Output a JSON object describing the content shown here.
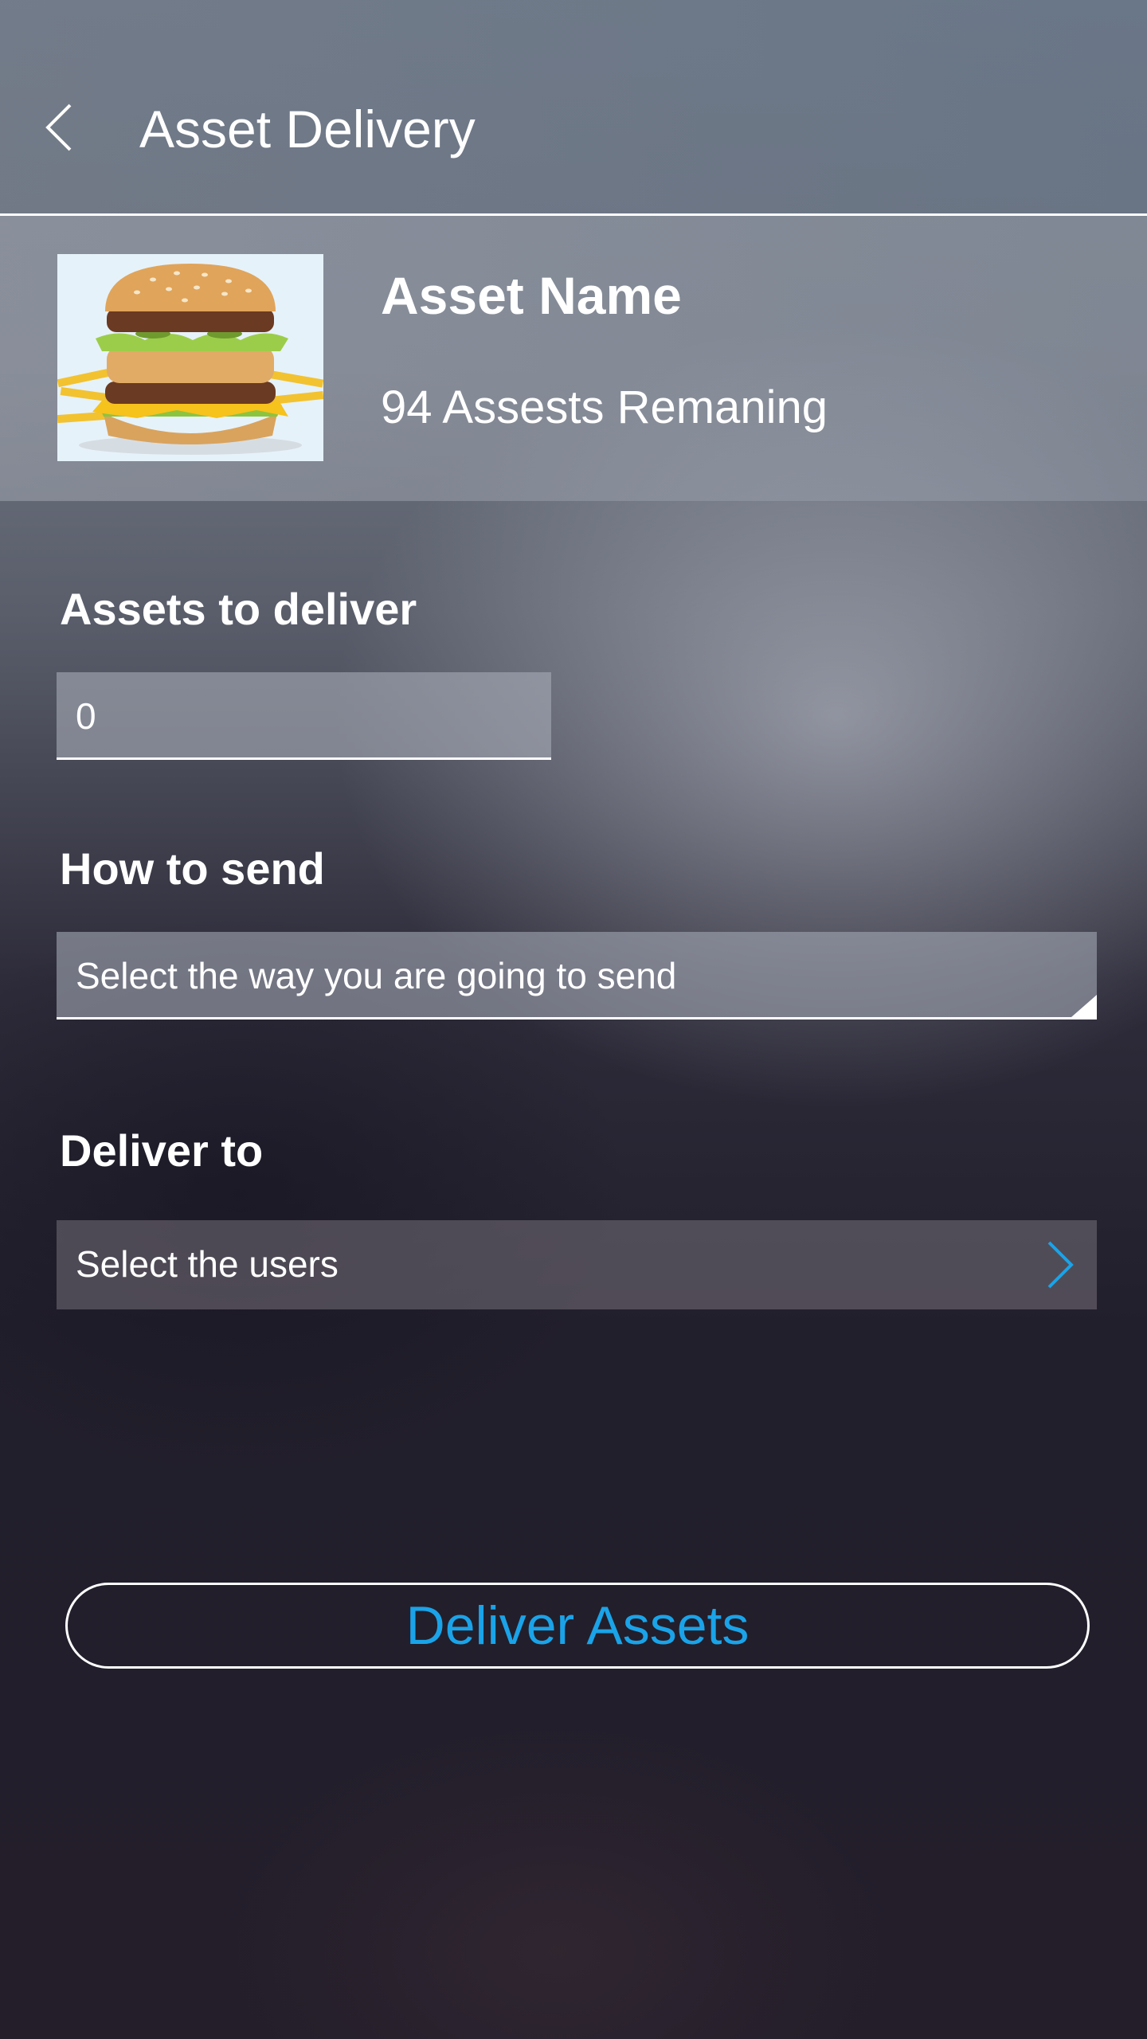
{
  "header": {
    "title": "Asset Delivery",
    "back_icon": "chevron-left-icon"
  },
  "asset": {
    "name": "Asset Name",
    "remaining": "94 Assests Remaning",
    "thumbnail": "burger-image"
  },
  "form": {
    "quantity_label": "Assets to deliver",
    "quantity_value": "0",
    "send_label": "How to send",
    "send_placeholder": "Select the way you are going to send",
    "deliver_to_label": "Deliver to",
    "users_placeholder": "Select the users",
    "users_icon": "chevron-right-icon"
  },
  "actions": {
    "deliver_label": "Deliver Assets"
  },
  "colors": {
    "accent": "#1aa3e8",
    "text": "#ffffff"
  }
}
